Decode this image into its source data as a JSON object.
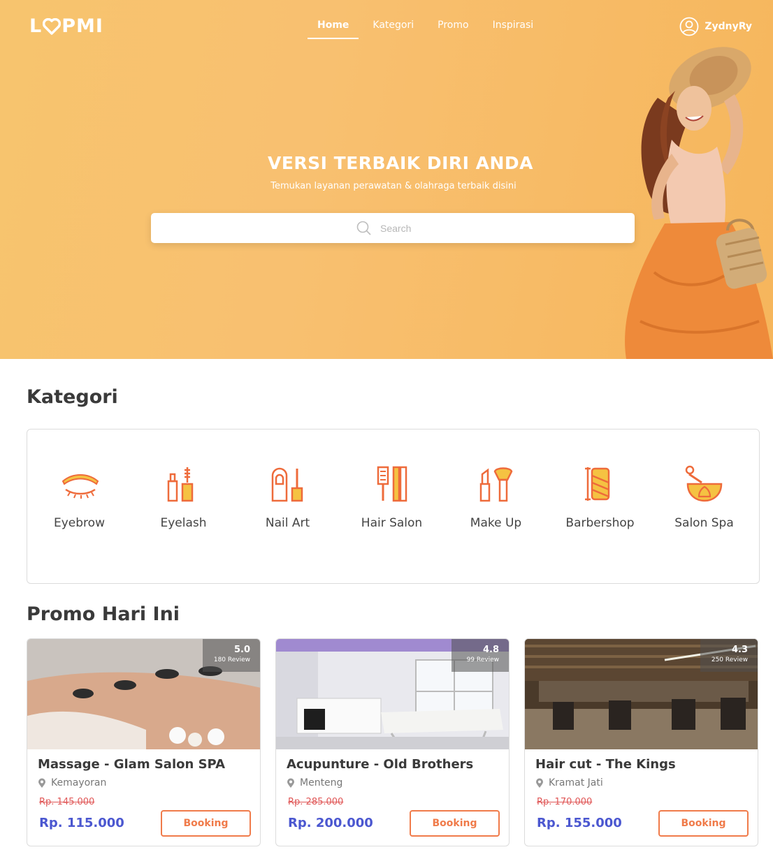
{
  "header": {
    "logo": "LOPMI",
    "nav": [
      "Home",
      "Kategori",
      "Promo",
      "Inspirasi"
    ],
    "active_nav": "Home",
    "username": "ZydnyRy"
  },
  "hero": {
    "title": "VERSI TERBAIK DIRI ANDA",
    "subtitle": "Temukan layanan perawatan & olahraga terbaik disini",
    "search_placeholder": "Search"
  },
  "kategori": {
    "title": "Kategori",
    "items": [
      {
        "label": "Eyebrow",
        "icon": "eyebrow-icon"
      },
      {
        "label": "Eyelash",
        "icon": "eyelash-icon"
      },
      {
        "label": "Nail Art",
        "icon": "nail-art-icon"
      },
      {
        "label": "Hair Salon",
        "icon": "hair-salon-icon"
      },
      {
        "label": "Make Up",
        "icon": "make-up-icon"
      },
      {
        "label": "Barbershop",
        "icon": "barbershop-icon"
      },
      {
        "label": "Salon Spa",
        "icon": "salon-spa-icon"
      }
    ]
  },
  "promo": {
    "title": "Promo Hari Ini",
    "booking_label": "Booking",
    "cards": [
      {
        "name": "Massage - Glam Salon SPA",
        "location": "Kemayoran",
        "old_price": "Rp. 145.000",
        "price": "Rp. 115.000",
        "rating": "5.0",
        "reviews": "180 Review"
      },
      {
        "name": "Acupunture - Old Brothers",
        "location": "Menteng",
        "old_price": "Rp. 285.000",
        "price": "Rp. 200.000",
        "rating": "4.8",
        "reviews": "99 Review"
      },
      {
        "name": "Hair cut - The Kings",
        "location": "Kramat Jati",
        "old_price": "Rp. 170.000",
        "price": "Rp. 155.000",
        "rating": "4.3",
        "reviews": "250 Review"
      }
    ]
  },
  "colors": {
    "hero": "#f7c46e",
    "accent": "#f07b4a",
    "price": "#4b57d0",
    "strike": "#e05757"
  }
}
